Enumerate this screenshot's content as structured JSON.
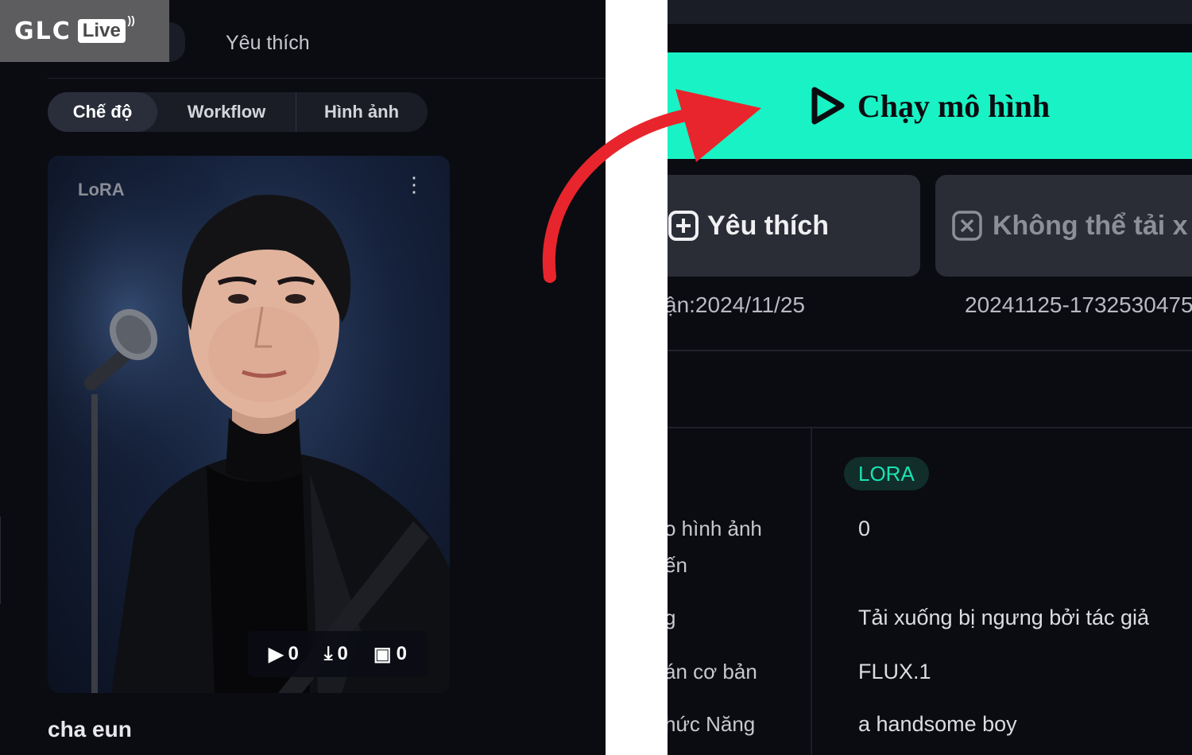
{
  "logo": {
    "brand": "GLC",
    "badge": "Live"
  },
  "left": {
    "tabs": {
      "favorites": "Yêu thích"
    },
    "segments": [
      "Chế độ",
      "Workflow",
      "Hình ảnh"
    ],
    "card": {
      "badge": "LoRA",
      "title": "cha eun",
      "stats": {
        "runs": "0",
        "downloads": "0",
        "images": "0"
      }
    }
  },
  "right": {
    "run_button": "Chạy mô hình",
    "favorite_button": "Yêu thích",
    "download_button": "Không thể tải x",
    "date_partial": "ận:2024/11/25",
    "id_partial": "20241125-1732530475",
    "type_badge": "LORA",
    "rows": [
      {
        "label": "o hình ảnh",
        "value": "0"
      },
      {
        "label": "ến",
        "value": ""
      },
      {
        "label": "g",
        "value": "Tải xuống bị ngưng bởi tác giả"
      },
      {
        "label": "án cơ bản",
        "value": "FLUX.1"
      },
      {
        "label": "hức Năng",
        "value": "a handsome boy"
      }
    ]
  },
  "colors": {
    "accent": "#19f2c4",
    "arrow": "#e8252c",
    "background": "#0b0c11"
  }
}
